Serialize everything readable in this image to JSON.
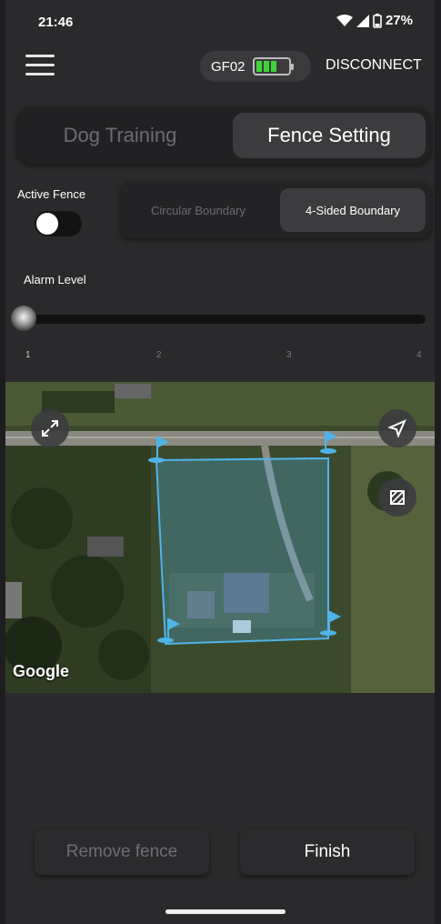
{
  "status_bar": {
    "time": "21:46",
    "battery": "27%"
  },
  "header": {
    "device_name": "GF02",
    "battery_bars": 3,
    "disconnect_label": "DISCONNECT"
  },
  "mode_tabs": {
    "inactive": "Dog Training",
    "active": "Fence Setting"
  },
  "active_fence": {
    "label": "Active Fence",
    "enabled": false
  },
  "boundary": {
    "circular": "Circular Boundary",
    "four_sided": "4-Sided Boundary",
    "selected": "4-Sided Boundary"
  },
  "alarm": {
    "label": "Alarm Level",
    "value": 1,
    "ticks": [
      "1",
      "2",
      "3",
      "4"
    ]
  },
  "map": {
    "attribution": "Google",
    "fence_color": "#4fb3e8"
  },
  "actions": {
    "remove_label": "Remove fence",
    "finish_label": "Finish"
  },
  "colors": {
    "accent": "#4fb3e8",
    "battery_green": "#3fd43a"
  }
}
